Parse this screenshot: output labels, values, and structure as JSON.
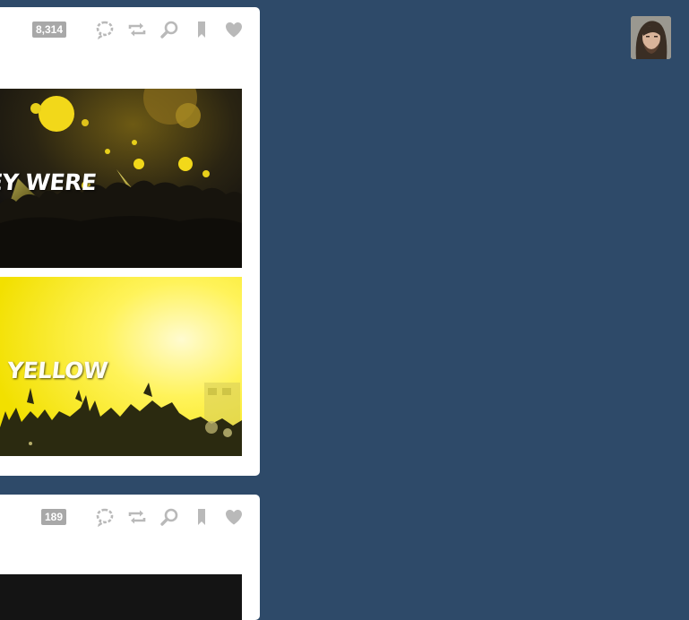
{
  "colors": {
    "background": "#2e4a69",
    "card": "#ffffff",
    "control_gray": "#b9b9b9",
    "badge_gray": "#a8a8a8",
    "photo_yellow": "#f5e800"
  },
  "posts": [
    {
      "notes_count": "8,314",
      "controls": [
        "reply-icon",
        "reblog-icon",
        "search-icon",
        "bookmark-icon",
        "heart-icon"
      ],
      "photos": [
        {
          "caption": "EY WERE",
          "tone": "dark-yellow-concert"
        },
        {
          "caption": "YELLOW",
          "tone": "bright-yellow-concert"
        }
      ]
    },
    {
      "notes_count": "189",
      "controls": [
        "reply-icon",
        "reblog-icon",
        "search-icon",
        "bookmark-icon",
        "heart-icon"
      ],
      "photos": [
        {
          "caption": "",
          "tone": "dark"
        }
      ]
    }
  ],
  "avatar": {
    "icon": "user-avatar"
  }
}
